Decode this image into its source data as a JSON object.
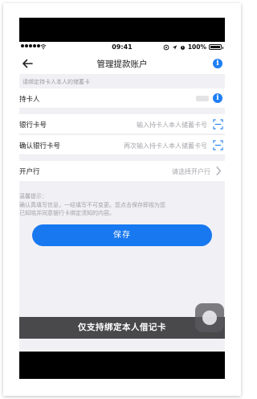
{
  "status_bar": {
    "time": "09:41",
    "battery": "100%"
  },
  "nav": {
    "title": "管理提款账户"
  },
  "hint": "请绑定持卡人本人的储蓄卡",
  "form": {
    "cardholder_label": "持卡人",
    "card_number_label": "银行卡号",
    "card_number_placeholder": "输入持卡人本人储蓄卡号",
    "confirm_card_label": "确认银行卡号",
    "confirm_card_placeholder": "再次输入持卡人本人储蓄卡号",
    "bank_label": "开户行",
    "bank_placeholder": "请选择开户行"
  },
  "tips": {
    "title": "温馨提示：",
    "line1": "确认真填写信息，一经填写不可变更。您点击保存即视为您",
    "line2": "已知晓并同意银行卡绑定须知的内容。"
  },
  "save_button": "保存",
  "toast": "仅支持绑定本人借记卡",
  "colors": {
    "accent": "#1878f0",
    "info_icon": "#1f7ef4",
    "background": "#f1f1f5"
  }
}
